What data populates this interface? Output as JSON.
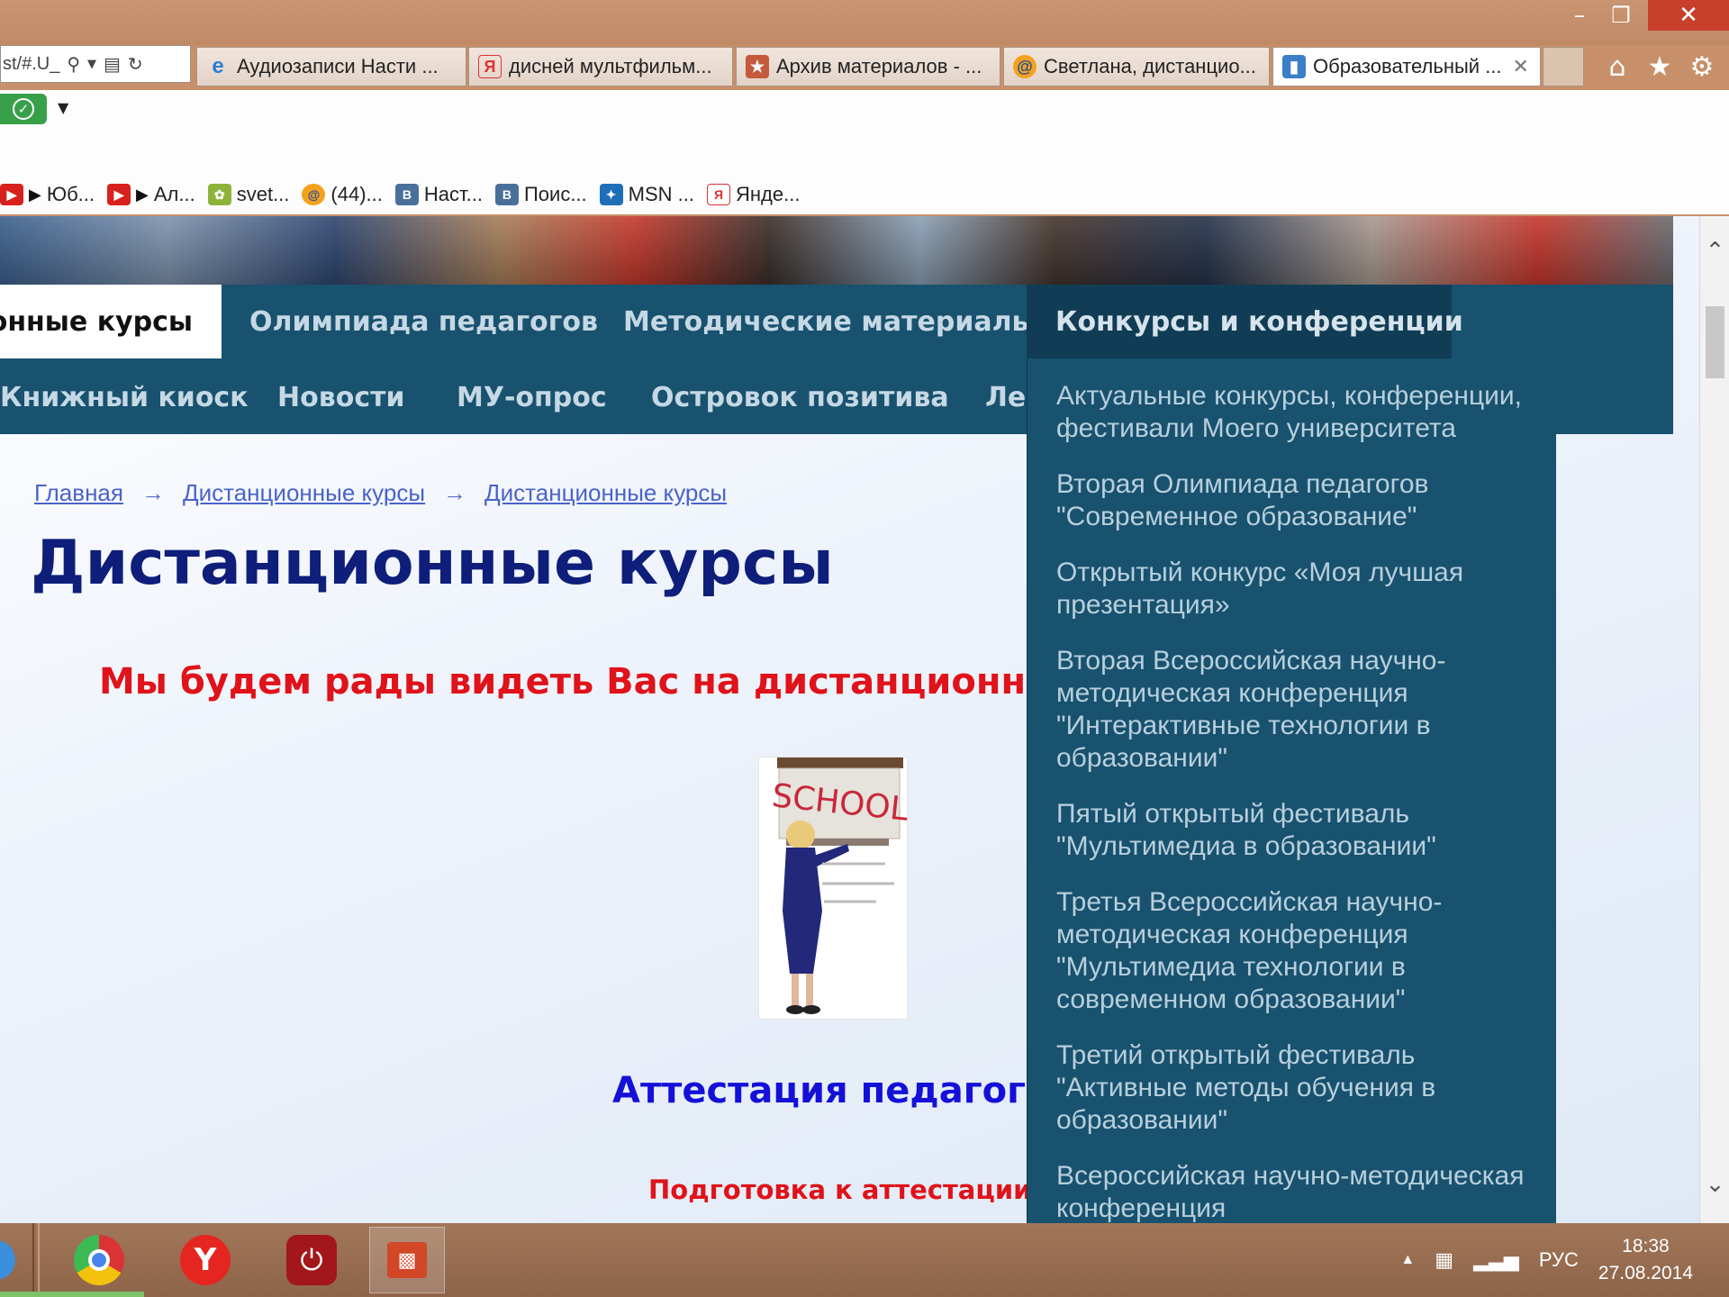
{
  "browser": {
    "address_text": "st/#.U_",
    "tabs": [
      {
        "label": "Аудиозаписи Насти ...",
        "icon": "ie-icon"
      },
      {
        "label": "дисней мультфильм...",
        "icon": "yandex-icon"
      },
      {
        "label": "Архив материалов - ...",
        "icon": "mascot-icon"
      },
      {
        "label": "Светлана, дистанцио...",
        "icon": "mail-icon"
      },
      {
        "label": "Образовательный ...",
        "icon": "site-icon",
        "active": true
      }
    ],
    "favorites": [
      {
        "label": "Юб...",
        "icon": "youtube-icon"
      },
      {
        "label": "Ал...",
        "icon": "youtube-icon"
      },
      {
        "label": "svet...",
        "icon": "leaf-icon"
      },
      {
        "label": "(44)...",
        "icon": "mail-icon"
      },
      {
        "label": "Наст...",
        "icon": "vk-icon",
        "letter": "B"
      },
      {
        "label": "Поис...",
        "icon": "vk-icon",
        "letter": "B"
      },
      {
        "label": "MSN ...",
        "icon": "msn-icon"
      },
      {
        "label": "Янде...",
        "icon": "yandex-icon",
        "letter": "Я"
      }
    ]
  },
  "page": {
    "nav_row1": [
      "ионные курсы",
      "Олимпиада педагогов",
      "Методические материалы",
      "Конкурсы и конференции"
    ],
    "nav_row2": [
      "Книжный киоск",
      "Новости",
      "МУ-опрос",
      "Островок позитива",
      "Ле"
    ],
    "breadcrumb": [
      "Главная",
      "Дистанционные курсы",
      "Дистанционные курсы"
    ],
    "breadcrumb_arrow": "→",
    "title": "Дистанционные курсы",
    "welcome": "Мы будем рады видеть Вас на дистанционных к",
    "image_label": "SCHOOL",
    "attestation": "Аттестация педагогов",
    "preparation": "Подготовка к аттестации:",
    "dropdown_items": [
      "Актуальные конкурсы, конференции, фестивали Моего университета",
      "Вторая Олимпиада педагогов \"Современное образование\"",
      "Открытый конкурс «Моя лучшая презентация»",
      "Вторая Всероссийская научно-методическая конференция \"Интерактивные технологии в образовании\"",
      "Пятый открытый фестиваль \"Мультимедиа в образовании\"",
      "Третья Всероссийская научно-методическая конференция \"Мультимедиа технологии в современном образовании\"",
      "Третий открытый фестиваль \"Активные методы обучения в образовании\"",
      "Всероссийская научно-методическая конференция"
    ]
  },
  "taskbar": {
    "language": "РУС",
    "time": "18:38",
    "date": "27.08.2014"
  },
  "colors": {
    "nav_bg": "#18526f",
    "title": "#0e1e7a",
    "red_text": "#e0121a",
    "blue_text": "#1410d8",
    "link": "#4a63c8"
  }
}
